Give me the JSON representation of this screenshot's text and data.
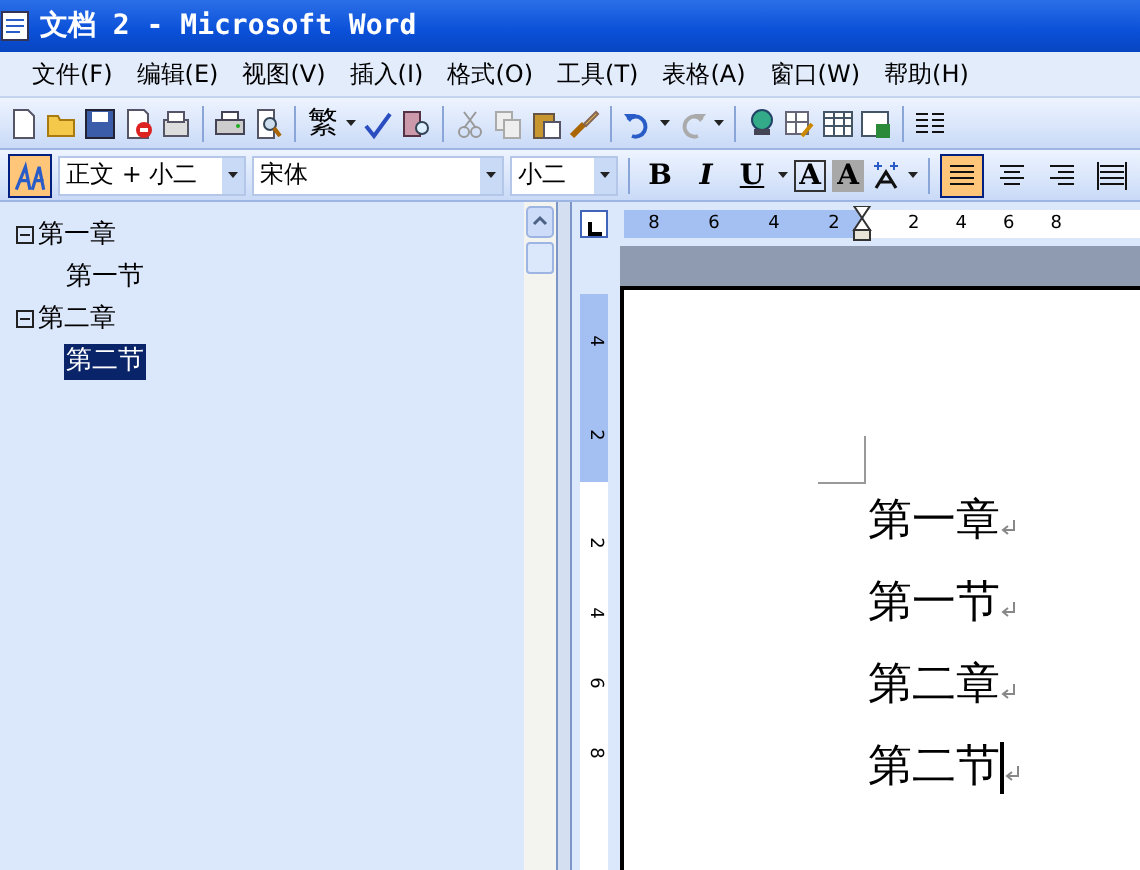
{
  "window": {
    "title": "文档 2 - Microsoft Word"
  },
  "menu": [
    "文件(F)",
    "编辑(E)",
    "视图(V)",
    "插入(I)",
    "格式(O)",
    "工具(T)",
    "表格(A)",
    "窗口(W)",
    "帮助(H)"
  ],
  "standard_toolbar": {
    "convert_label": "繁"
  },
  "formatting_toolbar": {
    "style": "正文 + 小二",
    "font": "宋体",
    "size": "小二",
    "bold": "B",
    "italic": "I",
    "underline": "U",
    "char_border": "A",
    "char_shading": "A",
    "alignment": [
      {
        "selected": true
      },
      {
        "selected": false
      },
      {
        "selected": false
      },
      {
        "selected": false
      }
    ]
  },
  "document_map": [
    {
      "label": "第一章",
      "expanded": true,
      "selected": false,
      "children": [
        {
          "label": "第一节",
          "selected": false
        }
      ]
    },
    {
      "label": "第二章",
      "expanded": true,
      "selected": false,
      "children": [
        {
          "label": "第二节",
          "selected": true
        }
      ]
    }
  ],
  "ruler": {
    "horizontal": [
      "8",
      "6",
      "4",
      "2",
      "2",
      "4",
      "6",
      "8"
    ],
    "vertical": [
      "4",
      "2",
      "2",
      "4",
      "6",
      "8"
    ]
  },
  "document": {
    "paragraphs": [
      "第一章",
      "第一节",
      "第二章",
      "第二节"
    ]
  }
}
